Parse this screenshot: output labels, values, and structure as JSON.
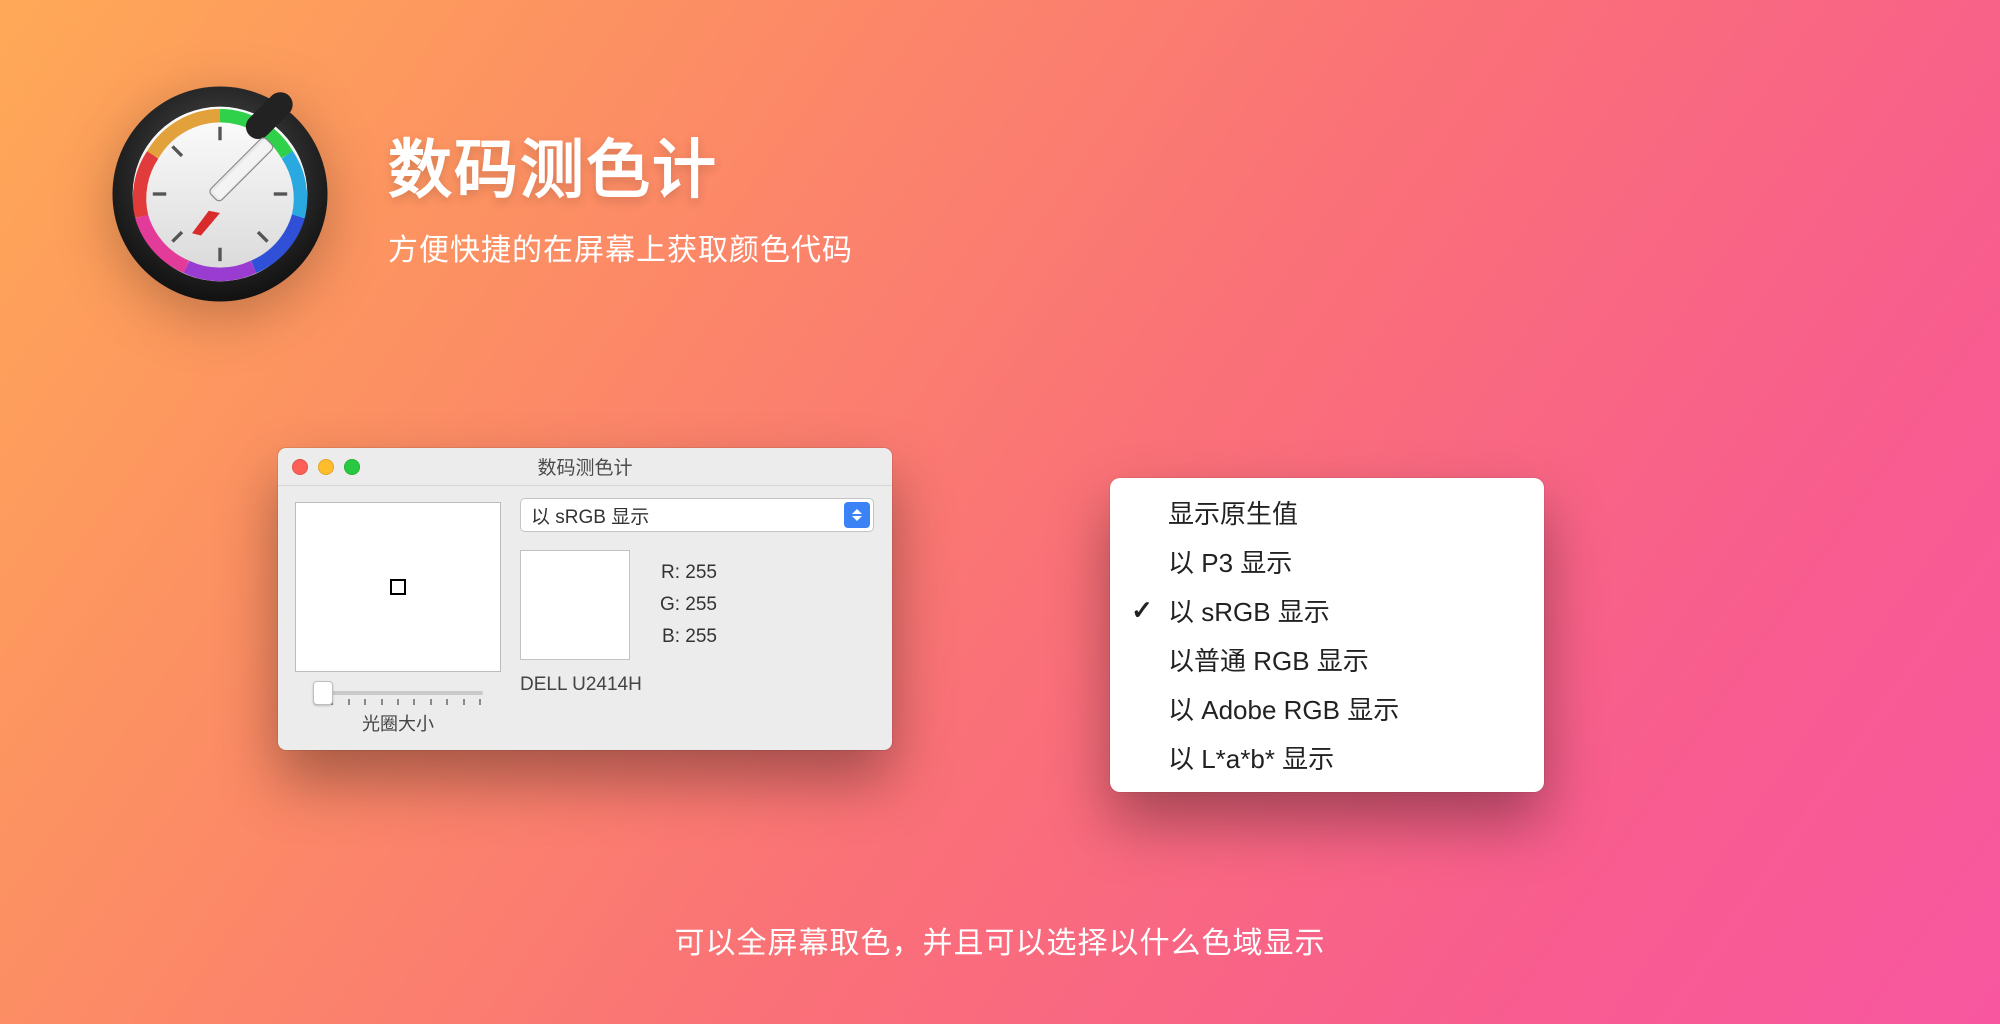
{
  "hero": {
    "title": "数码测色计",
    "subtitle": "方便快捷的在屏幕上获取颜色代码"
  },
  "window": {
    "title": "数码测色计",
    "select_label": "以 sRGB 显示",
    "r_label": "R:",
    "g_label": "G:",
    "b_label": "B:",
    "r_value": "255",
    "g_value": "255",
    "b_value": "255",
    "display_name": "DELL U2414H",
    "slider_label": "光圈大小"
  },
  "menu": {
    "items": [
      {
        "label": "显示原生值",
        "checked": false
      },
      {
        "label": "以 P3 显示",
        "checked": false
      },
      {
        "label": "以 sRGB 显示",
        "checked": true
      },
      {
        "label": "以普通 RGB 显示",
        "checked": false
      },
      {
        "label": "以 Adobe RGB 显示",
        "checked": false
      },
      {
        "label": "以 L*a*b* 显示",
        "checked": false
      }
    ]
  },
  "caption": "可以全屏幕取色，并且可以选择以什么色域显示"
}
